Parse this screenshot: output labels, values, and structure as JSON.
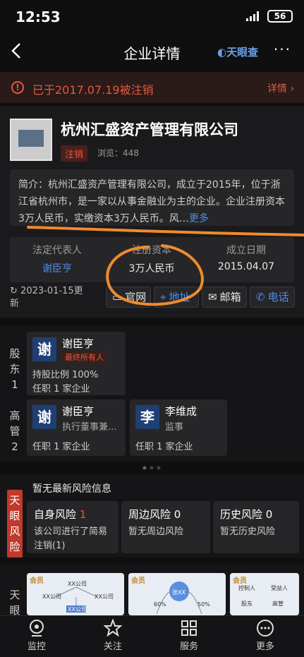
{
  "status": {
    "time": "12:53",
    "battery": "56"
  },
  "header": {
    "title": "企业详情",
    "brand": "天眼查",
    "more": "···"
  },
  "notice": {
    "text": "已于2017.07.19被注销",
    "detail": "详情 ›"
  },
  "company": {
    "name": "杭州汇盛资产管理有限公司",
    "status_tag": "注销",
    "views": "浏览：448",
    "intro": "简介：杭州汇盛资产管理有限公司，成立于2015年，位于浙江省杭州市，是一家以从事金融业为主的企业。企业注册资本3万人民币，实缴资本3万人民币。风…",
    "intro_more": "更多",
    "legal_rep_label": "法定代表人",
    "legal_rep": "谢臣亨",
    "capital_label": "注册资本",
    "capital": "3万人民币",
    "founded_label": "成立日期",
    "founded": "2015.04.07",
    "updated": "2023-01-15更\n新",
    "updated_a": "2023-01-15更",
    "updated_b": "新",
    "btn_web": "官网",
    "btn_addr": "地址",
    "btn_mail": "邮箱",
    "btn_phone": "电话"
  },
  "shareholders": {
    "side": [
      "股",
      "东",
      "1"
    ],
    "items": [
      {
        "avatar": "谢",
        "name": "谢臣亨",
        "badge": "最终所有人",
        "share": "持股比例 100%",
        "job": "任职 1 家企业"
      }
    ]
  },
  "executives": {
    "side": [
      "高",
      "管",
      "2"
    ],
    "items": [
      {
        "avatar": "谢",
        "name": "谢臣亨",
        "role": "执行董事兼...",
        "job": "任职 1 家企业"
      },
      {
        "avatar": "李",
        "name": "李维成",
        "role": "监事",
        "job": "任职 1 家企业"
      }
    ]
  },
  "risk": {
    "side": [
      "天",
      "眼",
      "风",
      "险"
    ],
    "headline": "暂无最新风险信息",
    "self": {
      "title": "自身风险",
      "count": "1",
      "desc1": "该公司进行了简易",
      "desc2": "注销(1)"
    },
    "around": {
      "title": "周边风险",
      "count": "0",
      "desc": "暂无周边风险"
    },
    "history": {
      "title": "历史风险",
      "count": "0",
      "desc": "暂无历史风险"
    }
  },
  "graphs": {
    "side": [
      "天",
      "眼"
    ],
    "vip": "会员",
    "g1": [
      "XX公司",
      "XX公司",
      "XX公司",
      "XX公司"
    ],
    "g2": [
      "张XX",
      "60%",
      "50%"
    ],
    "g3": [
      "控制人",
      "受益人",
      "股东",
      "高管"
    ]
  },
  "nav": [
    {
      "label": "监控",
      "icon": "monitor-icon"
    },
    {
      "label": "关注",
      "icon": "star-icon"
    },
    {
      "label": "服务",
      "icon": "grid-icon"
    },
    {
      "label": "更多",
      "icon": "more-icon"
    }
  ],
  "colors": {
    "accent": "#4f8ee8",
    "danger": "#e2593f",
    "annotation": "#f08a2e"
  }
}
